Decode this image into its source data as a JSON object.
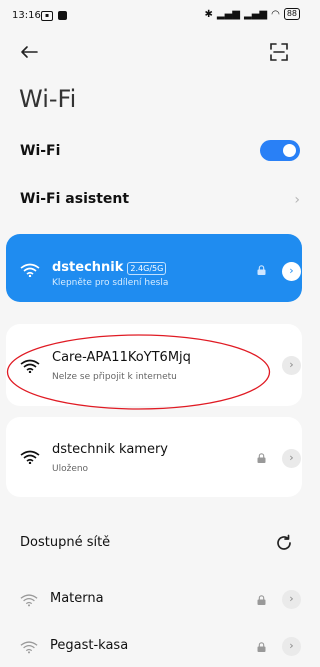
{
  "status": {
    "time": "13:16",
    "battery": "88"
  },
  "page": {
    "title": "Wi-Fi"
  },
  "settings": {
    "wifi_label": "Wi-Fi",
    "wifi_assistant_label": "Wi-Fi asistent"
  },
  "saved_networks": [
    {
      "ssid": "dstechnik",
      "badge": "2.4G/5G",
      "subtitle": "Klepněte pro sdílení hesla"
    },
    {
      "ssid": "Care-APA11KoYT6Mjq",
      "subtitle": "Nelze se připojit k internetu"
    },
    {
      "ssid": "dstechnik kamery",
      "subtitle": "Uloženo"
    }
  ],
  "available": {
    "section_label": "Dostupné sítě",
    "networks": [
      {
        "ssid": "Materna"
      },
      {
        "ssid": "Pegast-kasa"
      }
    ]
  },
  "colors": {
    "accent": "#1f8cf0",
    "annotation": "#e01b24"
  }
}
